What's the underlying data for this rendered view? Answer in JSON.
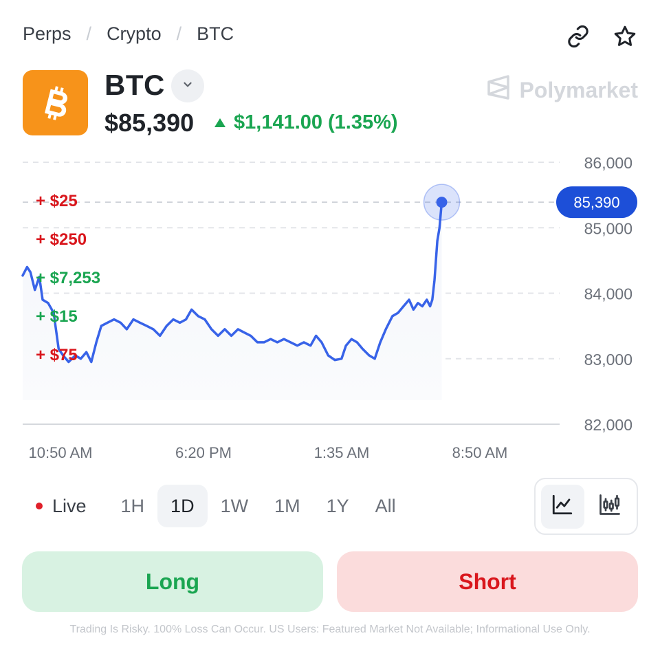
{
  "breadcrumb": {
    "items": [
      "Perps",
      "Crypto",
      "BTC"
    ],
    "separator": "/"
  },
  "header_icons": [
    "link-icon",
    "star-icon"
  ],
  "asset": {
    "logo_icon": "bitcoin-icon",
    "logo_color": "#f7931a",
    "name": "BTC",
    "price": "$85,390",
    "change_amount": "$1,141.00",
    "change_percent": "(1.35%)",
    "change_direction": "up",
    "up_color": "#1aa551"
  },
  "brand": {
    "name": "Polymarket",
    "icon": "polymarket-logo-icon"
  },
  "chart_data": {
    "type": "line",
    "series_color": "#3863e8",
    "current_value_label": "85,390",
    "current_value": 85390,
    "ylim": [
      82000,
      86000
    ],
    "y_ticks": [
      {
        "value": 86000,
        "label": "86,000"
      },
      {
        "value": 85000,
        "label": "85,000"
      },
      {
        "value": 84000,
        "label": "84,000"
      },
      {
        "value": 83000,
        "label": "83,000"
      },
      {
        "value": 82000,
        "label": "82,000"
      }
    ],
    "x_ticks": [
      "10:50 AM",
      "6:20 PM",
      "1:35 AM",
      "8:50 AM"
    ],
    "grid": "dashed-horizontal",
    "points": [
      [
        0,
        84270
      ],
      [
        0.8,
        84400
      ],
      [
        1.4,
        84320
      ],
      [
        2.2,
        84050
      ],
      [
        3,
        84250
      ],
      [
        3.6,
        83900
      ],
      [
        4.6,
        83850
      ],
      [
        5.6,
        83700
      ],
      [
        6.5,
        83150
      ],
      [
        7.3,
        83050
      ],
      [
        8.3,
        82950
      ],
      [
        9.5,
        83050
      ],
      [
        10.5,
        83000
      ],
      [
        11.5,
        83100
      ],
      [
        12.4,
        82950
      ],
      [
        13.3,
        83250
      ],
      [
        14.2,
        83500
      ],
      [
        15.3,
        83550
      ],
      [
        16.5,
        83600
      ],
      [
        17.7,
        83550
      ],
      [
        18.8,
        83450
      ],
      [
        20,
        83600
      ],
      [
        21.2,
        83550
      ],
      [
        22.4,
        83500
      ],
      [
        23.6,
        83450
      ],
      [
        24.8,
        83350
      ],
      [
        26,
        83500
      ],
      [
        27.2,
        83600
      ],
      [
        28.4,
        83550
      ],
      [
        29.5,
        83600
      ],
      [
        30.5,
        83750
      ],
      [
        31.7,
        83650
      ],
      [
        32.9,
        83600
      ],
      [
        34.1,
        83450
      ],
      [
        35.3,
        83350
      ],
      [
        36.5,
        83450
      ],
      [
        37.7,
        83350
      ],
      [
        38.9,
        83450
      ],
      [
        40,
        83400
      ],
      [
        41.2,
        83350
      ],
      [
        42.4,
        83250
      ],
      [
        43.6,
        83250
      ],
      [
        44.8,
        83300
      ],
      [
        46,
        83250
      ],
      [
        47.2,
        83300
      ],
      [
        48.4,
        83250
      ],
      [
        49.6,
        83200
      ],
      [
        50.8,
        83250
      ],
      [
        52,
        83200
      ],
      [
        53,
        83350
      ],
      [
        54,
        83250
      ],
      [
        55.2,
        83050
      ],
      [
        56.4,
        82980
      ],
      [
        57.6,
        83000
      ],
      [
        58.4,
        83200
      ],
      [
        59.4,
        83300
      ],
      [
        60.4,
        83250
      ],
      [
        61.4,
        83150
      ],
      [
        62.6,
        83050
      ],
      [
        63.6,
        83000
      ],
      [
        64.6,
        83250
      ],
      [
        65.6,
        83450
      ],
      [
        66.8,
        83650
      ],
      [
        67.8,
        83700
      ],
      [
        68.8,
        83800
      ],
      [
        69.8,
        83900
      ],
      [
        70.6,
        83750
      ],
      [
        71.4,
        83850
      ],
      [
        72.2,
        83800
      ],
      [
        73,
        83900
      ],
      [
        73.6,
        83800
      ],
      [
        74,
        83900
      ],
      [
        74.4,
        84200
      ],
      [
        74.9,
        84800
      ],
      [
        75.3,
        85000
      ],
      [
        75.7,
        85390
      ]
    ]
  },
  "annotations": [
    {
      "text": "+ $25",
      "tone": "red"
    },
    {
      "text": "+ $250",
      "tone": "red"
    },
    {
      "text": "+ $7,253",
      "tone": "green"
    },
    {
      "text": "+ $15",
      "tone": "green"
    },
    {
      "text": "+ $75",
      "tone": "red"
    }
  ],
  "ranges": {
    "live_label": "Live",
    "options": [
      "1H",
      "1D",
      "1W",
      "1M",
      "1Y",
      "All"
    ],
    "selected": "1D"
  },
  "chart_types": [
    {
      "icon": "line-chart-icon",
      "active": true
    },
    {
      "icon": "candlestick-chart-icon",
      "active": false
    }
  ],
  "actions": {
    "long_label": "Long",
    "short_label": "Short"
  },
  "disclaimer": "Trading Is Risky. 100% Loss Can Occur. US Users: Featured Market Not Available; Informational Use Only."
}
